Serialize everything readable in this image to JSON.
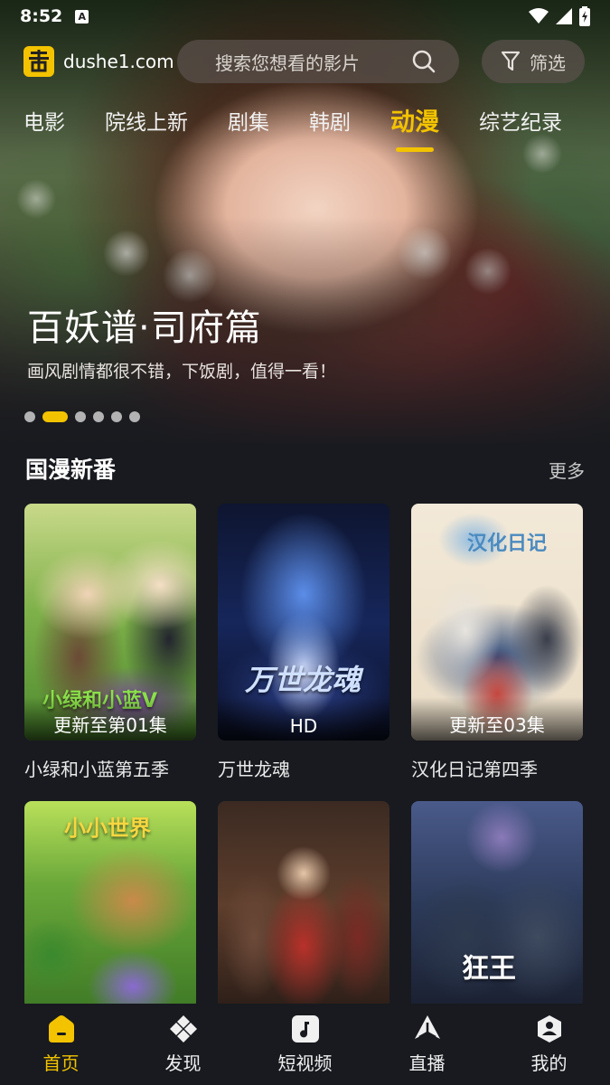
{
  "status_bar": {
    "time": "8:52",
    "notification_glyph": "A"
  },
  "header": {
    "site_name": "dushe1.com",
    "search_placeholder": "搜索您想看的影片",
    "filter_label": "筛选"
  },
  "tabs": [
    {
      "label": "电影",
      "active": false
    },
    {
      "label": "院线上新",
      "active": false
    },
    {
      "label": "剧集",
      "active": false
    },
    {
      "label": "韩剧",
      "active": false
    },
    {
      "label": "动漫",
      "active": true
    },
    {
      "label": "综艺纪录",
      "active": false
    }
  ],
  "banner": {
    "title": "百妖谱·司府篇",
    "subtitle": "画风剧情都很不错，下饭剧，值得一看！",
    "slide_count": 6,
    "active_slide": 1
  },
  "section": {
    "title": "国漫新番",
    "more_label": "更多",
    "items": [
      {
        "name": "小绿和小蓝第五季",
        "badge": "更新至第01集",
        "poster_text": "小绿和小蓝V"
      },
      {
        "name": "万世龙魂",
        "badge": "HD",
        "poster_text": "万世龙魂"
      },
      {
        "name": "汉化日记第四季",
        "badge": "更新至03集",
        "poster_text": "汉化日记"
      },
      {
        "name": "",
        "badge": "",
        "poster_text": "小小世界"
      },
      {
        "name": "",
        "badge": "",
        "poster_text": ""
      },
      {
        "name": "",
        "badge": "",
        "poster_text": "狂王"
      }
    ]
  },
  "bottom_nav": [
    {
      "label": "首页",
      "icon": "home-icon",
      "active": true
    },
    {
      "label": "发现",
      "icon": "discover-icon",
      "active": false
    },
    {
      "label": "短视频",
      "icon": "music-note-icon",
      "active": false
    },
    {
      "label": "直播",
      "icon": "live-icon",
      "active": false
    },
    {
      "label": "我的",
      "icon": "profile-icon",
      "active": false
    }
  ],
  "colors": {
    "accent": "#f3c300",
    "background": "#181a1f"
  }
}
